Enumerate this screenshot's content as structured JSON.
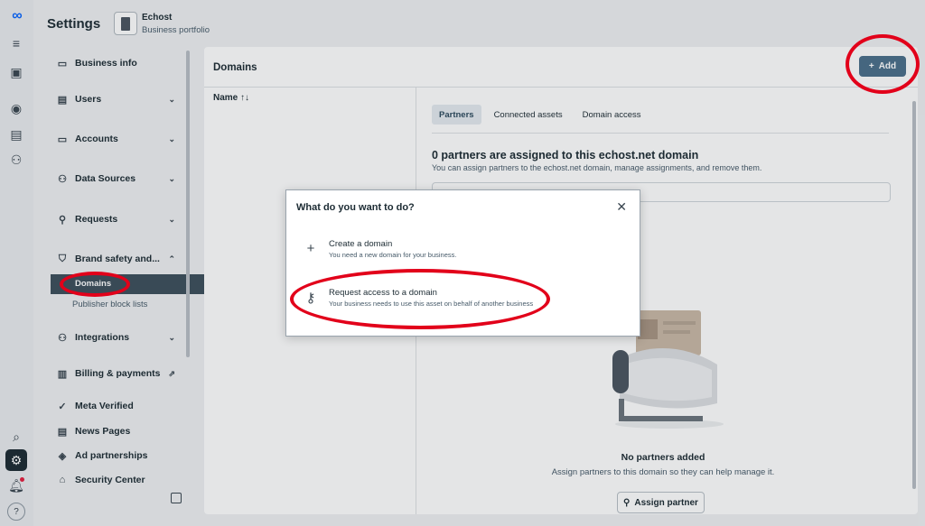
{
  "header": {
    "title": "Settings",
    "business_name": "Echost",
    "business_sub": "Business portfolio"
  },
  "rail": [
    "meta-logo-icon",
    "menu-icon",
    "business-icon",
    "compass-icon",
    "pages-icon",
    "connections-icon",
    "search-icon",
    "gear-icon",
    "bell-icon",
    "help-icon"
  ],
  "nav": {
    "items": [
      {
        "label": "Business info",
        "icon": "briefcase-icon"
      },
      {
        "label": "Users",
        "icon": "users-icon"
      },
      {
        "label": "Accounts",
        "icon": "accounts-icon"
      },
      {
        "label": "Data Sources",
        "icon": "data-sources-icon"
      },
      {
        "label": "Requests",
        "icon": "requests-icon"
      },
      {
        "label": "Brand safety and...",
        "icon": "shield-icon"
      },
      {
        "label": "Integrations",
        "icon": "integrations-icon"
      },
      {
        "label": "Billing & payments",
        "icon": "bank-icon"
      },
      {
        "label": "Meta Verified",
        "icon": "verified-icon"
      },
      {
        "label": "News Pages",
        "icon": "news-icon"
      },
      {
        "label": "Ad partnerships",
        "icon": "ad-partnerships-icon"
      },
      {
        "label": "Security Center",
        "icon": "security-icon"
      }
    ],
    "sub": {
      "domains": "Domains",
      "publisher": "Publisher block lists"
    }
  },
  "main": {
    "title": "Domains",
    "add_label": "Add",
    "name_header": "Name ↑↓",
    "tabs": [
      "Partners",
      "Connected assets",
      "Domain access"
    ],
    "partners_title": "0 partners are assigned to this echost.net domain",
    "partners_desc": "You can assign partners to the echost.net domain, manage assignments, and remove them.",
    "empty_title": "No partners added",
    "empty_sub": "Assign partners to this domain so they can help manage it.",
    "assign_label": "Assign partner"
  },
  "dialog": {
    "title": "What do you want to do?",
    "options": [
      {
        "label": "Create a domain",
        "desc": "You need a new domain for your business.",
        "icon": "plus-icon"
      },
      {
        "label": "Request access to a domain",
        "desc": "Your business needs to use this asset on behalf of another business",
        "icon": "key-icon"
      }
    ]
  },
  "colors": {
    "accent": "#4a6f8a",
    "annotation": "#e2001a",
    "selected_nav": "#3d4f5c"
  }
}
